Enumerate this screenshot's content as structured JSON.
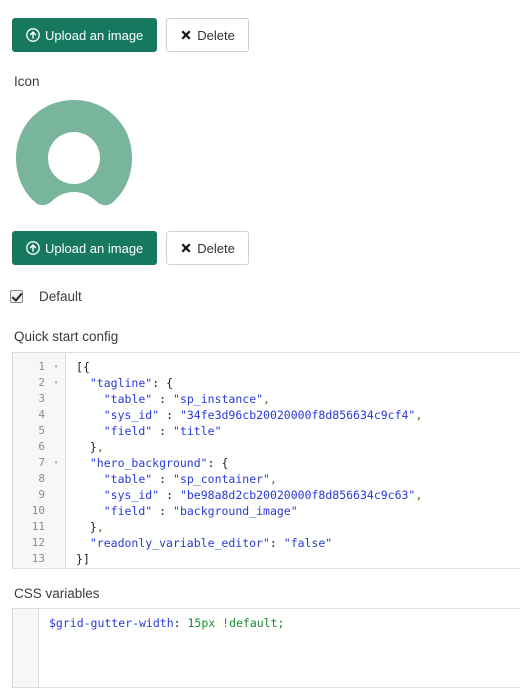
{
  "theme": {
    "primary_button_bg": "#16795f",
    "icon_green": "#79b49c",
    "editor_border": "#dddddd",
    "gutter_bg": "#f7f7f7",
    "json_token_color": "#2a3ad6",
    "scss_value_color": "#1a8a2e"
  },
  "logo_section": {
    "upload_button_label": "Upload an image",
    "upload_icon": "upload-circle-arrow-icon",
    "delete_button_label": "Delete",
    "delete_icon": "close-x-icon"
  },
  "icon_section": {
    "label": "Icon",
    "preview_icon_name": "servicenow-q-logo",
    "upload_button_label": "Upload an image",
    "upload_icon": "upload-circle-arrow-icon",
    "delete_button_label": "Delete",
    "delete_icon": "close-x-icon"
  },
  "default_checkbox": {
    "label": "Default",
    "checked": true
  },
  "quick_start_config": {
    "label": "Quick start config",
    "line_count": 13,
    "fold_lines": [
      1,
      2,
      7
    ],
    "fold_glyph": "▾",
    "line_numbers": [
      "1",
      "2",
      "3",
      "4",
      "5",
      "6",
      "7",
      "8",
      "9",
      "10",
      "11",
      "12",
      "13"
    ],
    "lines": [
      "[{",
      "  \"tagline\": {",
      "    \"table\" : \"sp_instance\",",
      "    \"sys_id\" : \"34fe3d96cb20020000f8d856634c9cf4\",",
      "    \"field\" : \"title\"",
      "  },",
      "  \"hero_background\": {",
      "    \"table\" : \"sp_container\",",
      "    \"sys_id\" : \"be98a8d2cb20020000f8d856634c9c63\",",
      "    \"field\" : \"background_image\"",
      "  },",
      "  \"readonly_variable_editor\": \"false\"",
      "}]"
    ]
  },
  "css_variables": {
    "label": "CSS variables",
    "lines": [
      "$grid-gutter-width: 15px !default;"
    ],
    "tokens": {
      "variable": "$grid-gutter-width",
      "colon": ":",
      "value": "15px",
      "flag": "!default",
      "semicolon": ";"
    }
  }
}
